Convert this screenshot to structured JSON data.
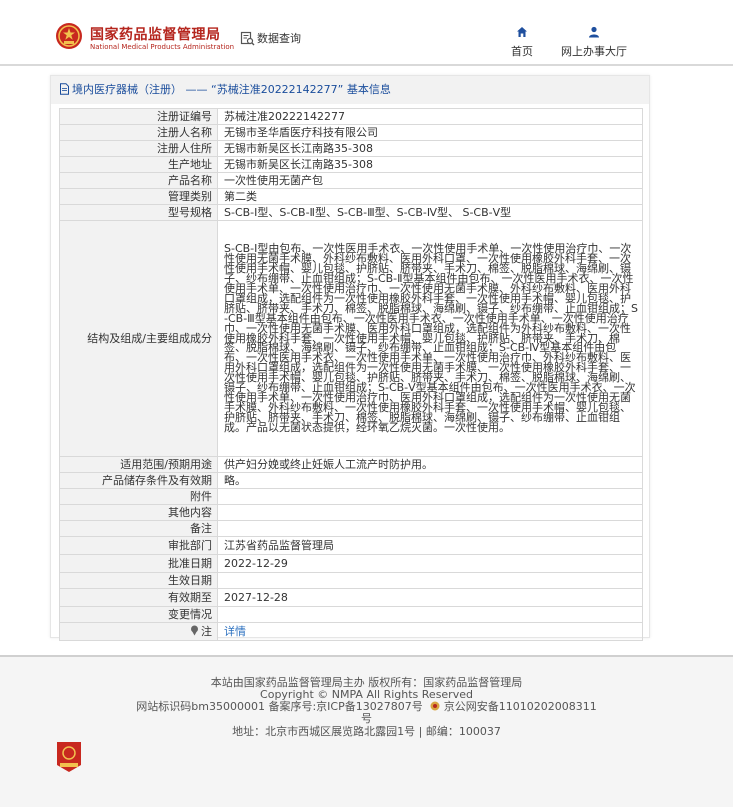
{
  "header": {
    "brand_cn": "国家药品监督管理局",
    "brand_en": "National Medical Products Administration",
    "query_label": "数据查询",
    "nav": [
      {
        "label": "首页",
        "icon": "home-icon"
      },
      {
        "label": "网上办事大厅",
        "icon": "user-icon"
      }
    ],
    "brand_color": "#b5261e"
  },
  "panel": {
    "title": "境内医疗器械（注册） —— “苏械注准20222142277” 基本信息"
  },
  "table": {
    "rows": [
      {
        "key": "注册证编号",
        "value": "苏械注准20222142277"
      },
      {
        "key": "注册人名称",
        "value": "无锡市圣华盾医疗科技有限公司"
      },
      {
        "key": "注册人住所",
        "value": "无锡市新吴区长江南路35-308"
      },
      {
        "key": "生产地址",
        "value": "无锡市新吴区长江南路35-308"
      },
      {
        "key": "产品名称",
        "value": "一次性使用无菌产包"
      },
      {
        "key": "管理类别",
        "value": "第二类"
      },
      {
        "key": "型号规格",
        "value": "S-CB-Ⅰ型、S-CB-Ⅱ型、S-CB-Ⅲ型、S-CB-Ⅳ型、 S-CB-Ⅴ型"
      },
      {
        "key": "结构及组成/主要组成成分",
        "value": "S-CB-Ⅰ型由包布、一次性医用手术衣、一次性使用手术单、一次性使用治疗巾、一次性使用无菌手术膜、外科纱布敷料、医用外科口罩、一次性使用橡胶外科手套、一次性使用手术帽、婴儿包毯、护脐贴、脐带夹、手术刀、棉签、脱脂棉球、海绵刷、镊子、纱布绷带、止血钳组成；S-CB-Ⅱ型基本组件由包布、一次性医用手术衣、一次性使用手术单、一次性使用治疗巾、一次性使用无菌手术膜、外科纱布敷料、医用外科口罩组成，选配组件为一次性使用橡胶外科手套、一次性使用手术帽、婴儿包毯、护脐贴、脐带夹、手术刀、棉签、脱脂棉球、海绵刷、镊子、纱布绷带、止血钳组成；S-CB-Ⅲ型基本组件由包布、一次性医用手术衣、一次性使用手术单、一次性使用治疗巾、一次性使用无菌手术膜、医用外科口罩组成，选配组件为外科纱布敷料、一次性使用橡胶外科手套、一次性使用手术帽、婴儿包毯、护脐贴、脐带夹、手术刀、棉签、脱脂棉球、海绵刷、镊子、纱布绷带、止血钳组成；S-CB-Ⅳ型基本组件由包布、一次性医用手术衣、一次性使用手术单、一次性使用治疗巾、外科纱布敷料、医用外科口罩组成，选配组件为一次性使用无菌手术膜、一次性使用橡胶外科手套、一次性使用手术帽、婴儿包毯、护脐贴、脐带夹、手术刀、棉签、脱脂棉球、海绵刷、镊子、纱布绷带、止血钳组成；S-CB-Ⅴ型基本组件由包布、一次性医用手术衣、一次性使用手术单、一次性使用治疗巾、医用外科口罩组成，选配组件为一次性使用无菌手术膜、外科纱布敷料、一次性使用橡胶外科手套、一次性使用手术帽、婴儿包毯、护脐贴、脐带夹、手术刀、棉签、脱脂棉球、海绵刷、镊子、纱布绷带、止血钳组成。产品以无菌状态提供，经环氧乙烷灭菌。一次性使用。"
      },
      {
        "key": "适用范围/预期用途",
        "value": "供产妇分娩或终止妊娠人工流产时防护用。"
      },
      {
        "key": "产品储存条件及有效期",
        "value": "略。"
      },
      {
        "key": "附件",
        "value": ""
      },
      {
        "key": "其他内容",
        "value": ""
      },
      {
        "key": "备注",
        "value": ""
      },
      {
        "key": "审批部门",
        "value": "江苏省药品监督管理局"
      },
      {
        "key": "批准日期",
        "value": "2022-12-29"
      },
      {
        "key": "生效日期",
        "value": ""
      },
      {
        "key": "有效期至",
        "value": "2027-12-28"
      },
      {
        "key": "变更情况",
        "value": ""
      },
      {
        "key": "注",
        "value": "详情"
      }
    ]
  },
  "footer": {
    "line1": "本站由国家药品监督管理局主办 版权所有：国家药品监督管理局",
    "line2": "Copyright © NMPA All Rights Reserved",
    "line3": "网站标识码bm35000001   备案序号:京ICP备13027807号",
    "line3b": "京公网安备11010202008311",
    "line3c": "号",
    "line4": "地址：北京市西城区展览路北露园1号 | 邮编：100037"
  }
}
